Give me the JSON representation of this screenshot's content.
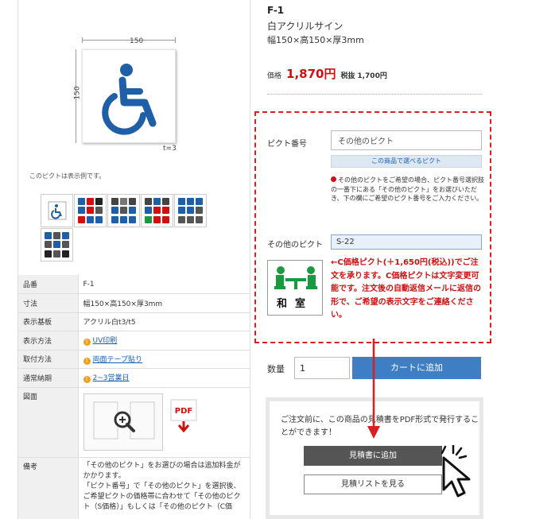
{
  "left": {
    "dim_width": "150",
    "dim_height": "150",
    "thickness": "t=3",
    "display_note": "このピクトは表示例です。",
    "spec_rows": [
      {
        "key": "品番",
        "value": "F-1"
      },
      {
        "key": "寸法",
        "value": "幅150×高150×厚3mm"
      },
      {
        "key": "表示基板",
        "value": "アクリル白t3/t5"
      },
      {
        "key": "表示方法",
        "value": "UV印刷"
      },
      {
        "key": "取付方法",
        "value": "両面テープ貼り"
      },
      {
        "key": "通常納期",
        "value": "2~3営業日"
      },
      {
        "key": "図面",
        "value": ""
      },
      {
        "key": "備考",
        "value": "「その他のピクト」をお選びの場合は追加料金がかかります。\n「ピクト番号」で「その他のピクト」を選択後、ご希望ピクトの価格帯に合わせて「その他のピクト（S価格）」もしくは「その他のピクト（C価"
      }
    ],
    "pdf_label": "PDF"
  },
  "right": {
    "code": "F-1",
    "name": "白アクリルサイン",
    "size": "幅150×高150×厚3mm",
    "price_label": "価格",
    "price": "1,870円",
    "price_tax_label": "税抜",
    "price_ex_tax": "1,700円",
    "pict_label": "ピクト番号",
    "pict_value": "その他のピクト",
    "pict_button": "この商品で選べるピクト",
    "pict_note": "その他のピクトをご希望の場合、ピクト番号選択肢の一番下にある「その他のピクト」をお選びいただき、下の欄にご希望のピクト番号をご入力ください。",
    "other_label": "その他のピクト",
    "other_value": "S-22",
    "washitsu_text": "和室",
    "c_price_note": "←C価格ピクト(＋1,650円(税込))でご注文を承ります。C価格ピクトは文字変更可能です。注文後の自動返信メールに返信の形で、ご希望の表示文字をご連絡ください。",
    "qty_label": "数量",
    "qty_value": "1",
    "cart_button": "カートに追加",
    "quote_text": "ご注文前に、この商品の見積書をPDF形式で発行することができます！",
    "quote_button": "見積書に追加",
    "quote_list_button": "見積リストを見る"
  },
  "colors": {
    "accent_red": "#d01010",
    "cart_blue": "#3e7ec4",
    "sign_blue": "#1f5fa8",
    "dashed_red": "#d82020"
  }
}
